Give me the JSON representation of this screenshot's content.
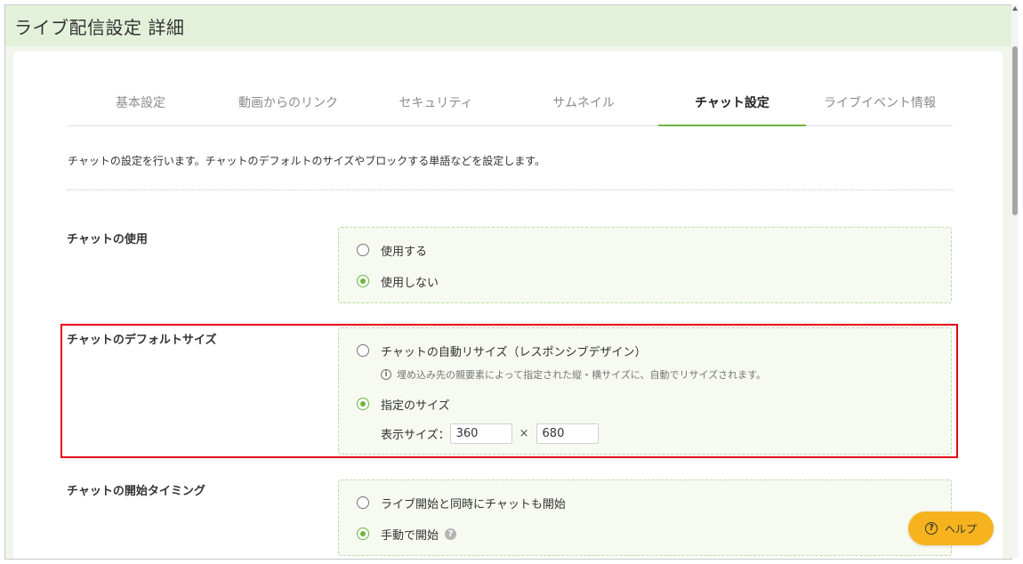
{
  "header": {
    "title": "ライブ配信設定 詳細"
  },
  "tabs": [
    {
      "label": "基本設定",
      "active": false
    },
    {
      "label": "動画からのリンク",
      "active": false
    },
    {
      "label": "セキュリティ",
      "active": false
    },
    {
      "label": "サムネイル",
      "active": false
    },
    {
      "label": "チャット設定",
      "active": true
    },
    {
      "label": "ライブイベント情報",
      "active": false
    }
  ],
  "intro": "チャットの設定を行います。チャットのデフォルトのサイズやブロックする単語などを設定します。",
  "sections": {
    "use": {
      "label": "チャットの使用",
      "options": [
        {
          "label": "使用する",
          "checked": false
        },
        {
          "label": "使用しない",
          "checked": true
        }
      ]
    },
    "default_size": {
      "label": "チャットのデフォルトサイズ",
      "options": [
        {
          "label": "チャットの自動リサイズ（レスポンシブデザイン）",
          "checked": false
        },
        {
          "label": "指定のサイズ",
          "checked": true
        }
      ],
      "note": "埋め込み先の親要素によって指定された縦・横サイズに、自動でリサイズされます。",
      "size_label": "表示サイズ：",
      "width_value": "360",
      "times": "×",
      "height_value": "680"
    },
    "start_timing": {
      "label": "チャットの開始タイミング",
      "options": [
        {
          "label": "ライブ開始と同時にチャットも開始",
          "checked": false
        },
        {
          "label": "手動で開始",
          "checked": true
        }
      ]
    }
  },
  "help": {
    "label": "ヘルプ",
    "icon": "help-circle-icon"
  },
  "colors": {
    "accent": "#6cb53f",
    "highlight": "#e60012",
    "help_button": "#f6b31e",
    "header_bg": "#e4f1da"
  }
}
